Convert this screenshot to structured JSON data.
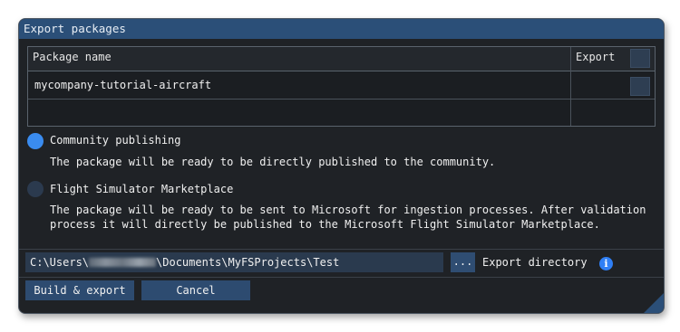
{
  "dialog": {
    "title": "Export packages"
  },
  "table": {
    "col_name": "Package name",
    "col_export": "Export",
    "rows": [
      {
        "name": "mycompany-tutorial-aircraft",
        "export_checked": false
      }
    ]
  },
  "options": {
    "community": {
      "label": "Community publishing",
      "description": "The package will be ready to be directly published to the community.",
      "selected": true
    },
    "marketplace": {
      "label": "Flight Simulator Marketplace",
      "description_line1": "The package will be ready to be sent to Microsoft for ingestion processes. After validation",
      "description_line2": "process it will directly be published to the Microsoft Flight Simulator Marketplace.",
      "selected": false
    }
  },
  "export": {
    "path_prefix": "C:\\Users\\",
    "path_suffix": "\\Documents\\MyFSProjects\\Test",
    "browse_label": "...",
    "directory_label": "Export directory",
    "info_glyph": "i"
  },
  "buttons": {
    "build": "Build & export",
    "cancel": "Cancel"
  },
  "colors": {
    "accent": "#2b4f78",
    "radio_selected": "#3a8cf0",
    "info": "#2f7ff5"
  }
}
